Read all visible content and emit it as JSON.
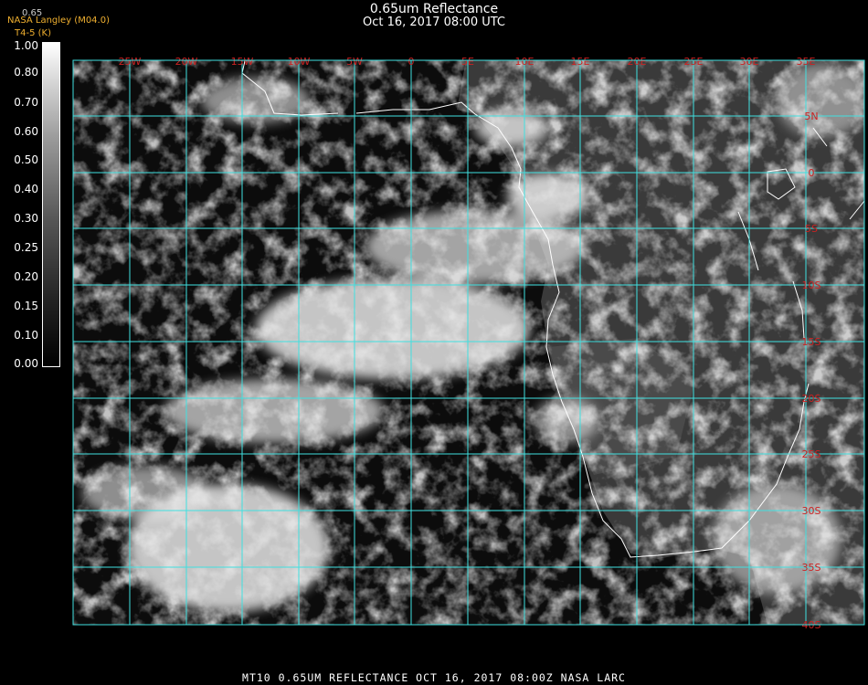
{
  "header": {
    "title": "0.65um Reflectance",
    "subtitle": "Oct 16, 2017 08:00 UTC",
    "small_top": "0.65",
    "credit": "NASA Langley (M04.0)",
    "credit2": "T4-5 (K)"
  },
  "colorbar": {
    "labels": [
      "1.00",
      "0.80",
      "0.70",
      "0.60",
      "0.50",
      "0.40",
      "0.30",
      "0.25",
      "0.20",
      "0.15",
      "0.10",
      "0.00"
    ],
    "colors": {
      "low": "#000000",
      "high": "#ffffff"
    }
  },
  "map": {
    "grid_color": "#40e0e0",
    "label_color": "#cc2222",
    "lon_labels": [
      "25W",
      "20W",
      "15W",
      "10W",
      "5W",
      "0",
      "5E",
      "10E",
      "15E",
      "20E",
      "25E",
      "30E",
      "35E"
    ],
    "lat_labels": [
      "5N",
      "0",
      "5S",
      "10S",
      "15S",
      "20S",
      "25S",
      "30S",
      "35S",
      "40S"
    ]
  },
  "footer": {
    "text": "MT10  0.65UM REFLECTANCE   OCT 16, 2017 08:00Z   NASA LARC"
  }
}
